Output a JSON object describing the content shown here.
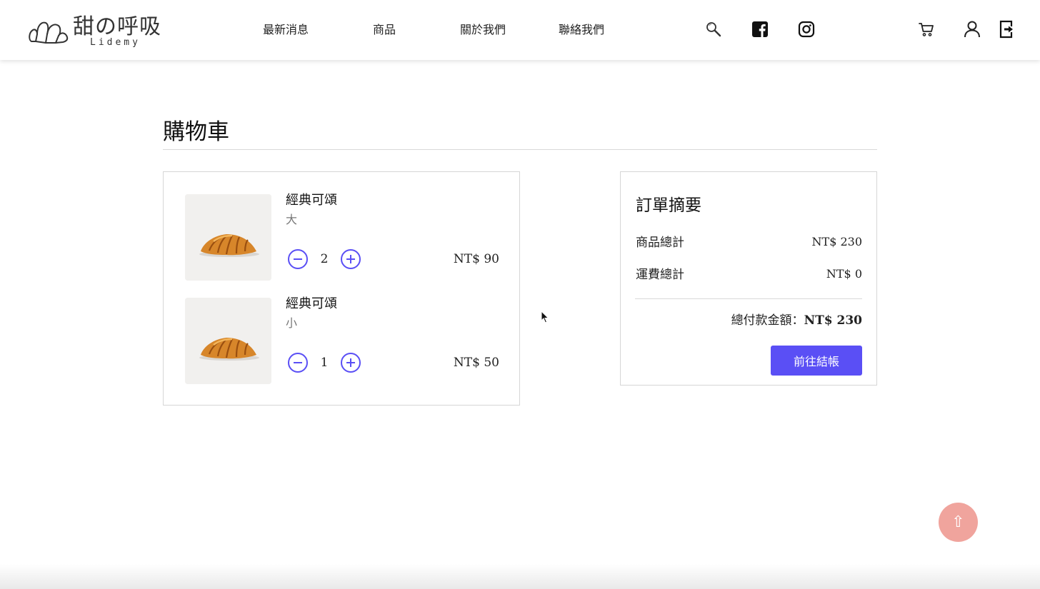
{
  "brand": {
    "name": "甜の呼吸",
    "sub": "Lidemy"
  },
  "nav": {
    "items": [
      {
        "label": "最新消息"
      },
      {
        "label": "商品"
      },
      {
        "label": "關於我們"
      },
      {
        "label": "聯絡我們"
      }
    ]
  },
  "header_icons": [
    "search-icon",
    "facebook-icon",
    "instagram-icon",
    "cart-icon",
    "user-icon",
    "logout-icon"
  ],
  "page": {
    "title": "購物車"
  },
  "cart": {
    "items": [
      {
        "name": "經典可頌",
        "size": "大",
        "qty": "2",
        "price": "NT$ 90"
      },
      {
        "name": "經典可頌",
        "size": "小",
        "qty": "1",
        "price": "NT$ 50"
      }
    ]
  },
  "summary": {
    "title": "訂單摘要",
    "subtotal_label": "商品總計",
    "subtotal_value": "NT$ 230",
    "shipping_label": "運費總計",
    "shipping_value": "NT$ 0",
    "total_label": "總付款金額：",
    "total_value": "NT$ 230",
    "checkout_label": "前往結帳"
  },
  "back_to_top": {
    "glyph": "⇧"
  },
  "colors": {
    "accent": "#5a4ff5",
    "back_to_top": "#f0a49d"
  }
}
